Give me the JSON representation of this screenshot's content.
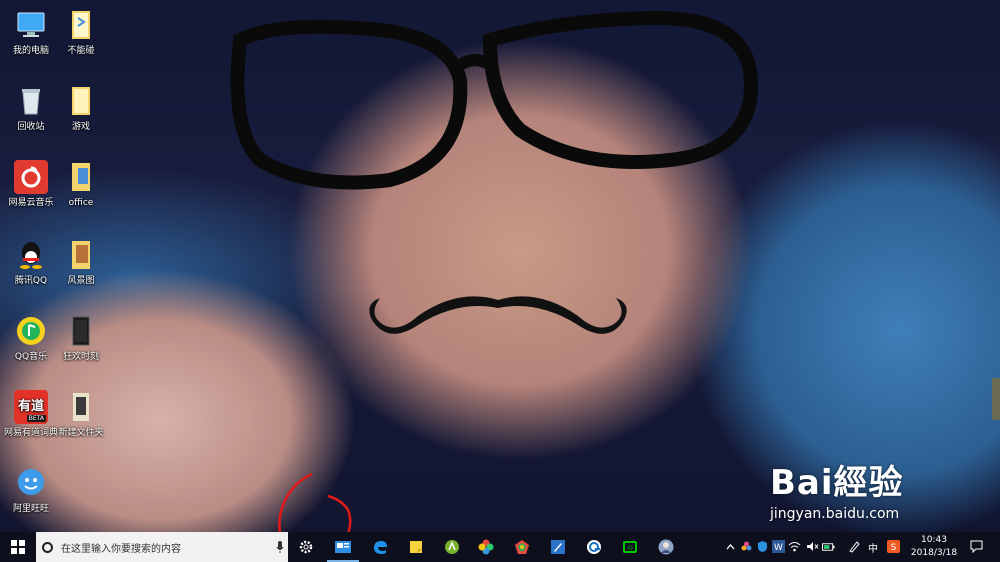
{
  "desktop": {
    "icons": [
      {
        "label": "我的电脑",
        "icon": "computer-icon"
      },
      {
        "label": "不能碰",
        "icon": "folder-icon"
      },
      {
        "label": "回收站",
        "icon": "recycle-bin-icon"
      },
      {
        "label": "游戏",
        "icon": "folder-icon"
      },
      {
        "label": "网易云音乐",
        "icon": "netease-music-icon"
      },
      {
        "label": "office",
        "icon": "folder-icon"
      },
      {
        "label": "腾讯QQ",
        "icon": "qq-icon"
      },
      {
        "label": "风景图",
        "icon": "folder-icon"
      },
      {
        "label": "QQ音乐",
        "icon": "qq-music-icon"
      },
      {
        "label": "狂欢时刻",
        "icon": "folder-dark-icon"
      },
      {
        "label": "网易有道词典",
        "icon": "youdao-icon"
      },
      {
        "label": "新建文件夹",
        "icon": "folder-icon"
      },
      {
        "label": "阿里旺旺",
        "icon": "aliwangwang-icon"
      }
    ],
    "youdao_badge": "BETA",
    "youdao_glyph": "有道"
  },
  "watermark": {
    "logo": "Bai經验",
    "url": "jingyan.baidu.com"
  },
  "taskbar": {
    "search_placeholder": "在这里输入你要搜索的内容",
    "ime_label": "中",
    "time": "10:43",
    "date": "2018/3/18",
    "pinned_apps": [
      "settings-icon",
      "news-icon",
      "edge-icon",
      "sticky-notes-icon",
      "green-app-icon",
      "color-wheel-icon",
      "chrome-like-icon",
      "pen-app-icon",
      "browser-icon",
      "iqiyi-icon",
      "avatar-icon"
    ]
  },
  "colors": {
    "taskbar_bg": "#0e0f1c",
    "search_bg": "#f2f2f2",
    "accent": "#7ab3e8",
    "annotation_red": "#e01818"
  }
}
